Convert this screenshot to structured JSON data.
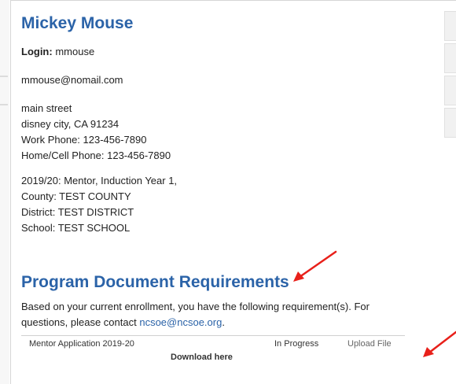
{
  "profile": {
    "name": "Mickey Mouse",
    "login_label": "Login:",
    "login_value": "mmouse",
    "email": "mmouse@nomail.com",
    "street": "main street",
    "city_line": "disney city, CA 91234",
    "work_phone": "Work Phone: 123-456-7890",
    "home_phone": "Home/Cell Phone: 123-456-7890",
    "enrollment": "2019/20: Mentor, Induction Year 1,",
    "county": "County: TEST COUNTY",
    "district": "District: TEST DISTRICT",
    "school": "School: TEST SCHOOL"
  },
  "requirements": {
    "title": "Program Document Requirements",
    "intro_text": "Based on your current enrollment, you have the following requirement(s). For questions, please contact",
    "contact_email": "ncsoe@ncsoe.org",
    "intro_end": ".",
    "rows": [
      {
        "document": "Mentor Application 2019-20",
        "status": "In Progress",
        "action": "Upload File",
        "download": "Download here"
      }
    ]
  },
  "colors": {
    "heading": "#2b63a8",
    "annotation_arrow": "#e8201a"
  }
}
